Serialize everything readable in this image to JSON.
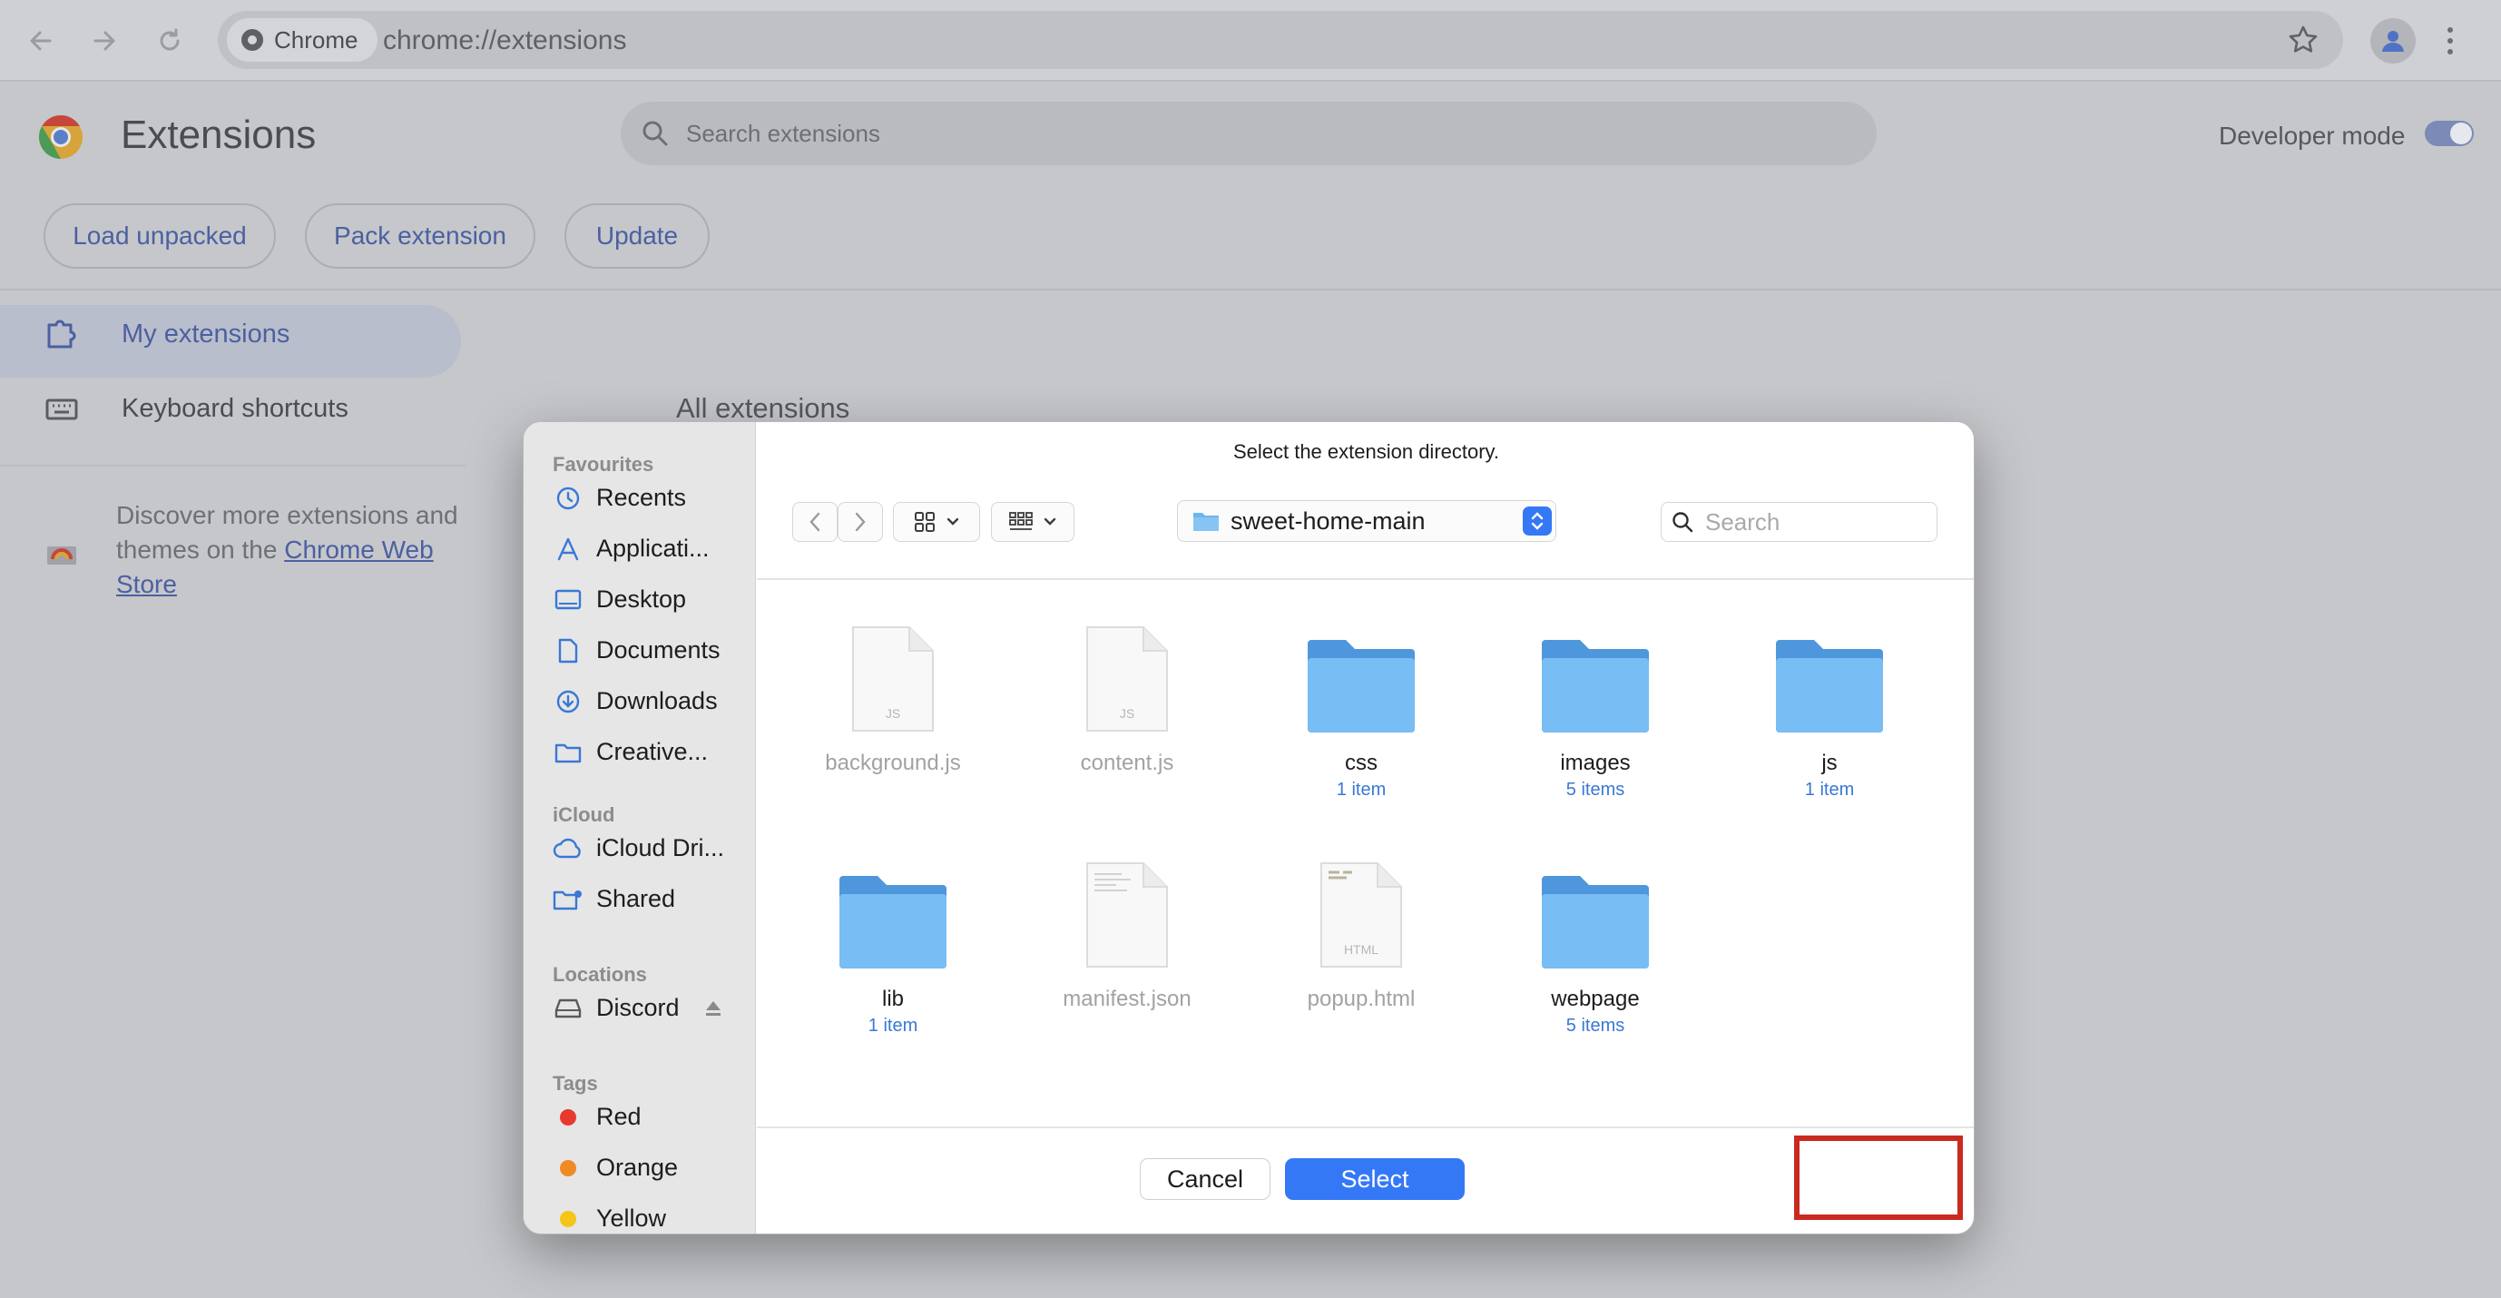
{
  "browser": {
    "chip_label": "Chrome",
    "url": "chrome://extensions"
  },
  "extensions_page": {
    "title": "Extensions",
    "search_placeholder": "Search extensions",
    "developer_mode_label": "Developer mode",
    "developer_mode_on": true,
    "buttons": {
      "load_unpacked": "Load unpacked",
      "pack_extension": "Pack extension",
      "update": "Update"
    },
    "nav": {
      "my_extensions": "My extensions",
      "keyboard_shortcuts": "Keyboard shortcuts"
    },
    "discover": {
      "text": "Discover more extensions and themes on the ",
      "link": "Chrome Web Store"
    },
    "all_extensions_heading": "All extensions"
  },
  "dialog": {
    "prompt": "Select the extension directory.",
    "current_folder": "sweet-home-main",
    "search_placeholder": "Search",
    "sidebar": {
      "favourites_label": "Favourites",
      "favourites": [
        "Recents",
        "Applicati...",
        "Desktop",
        "Documents",
        "Downloads",
        "Creative..."
      ],
      "icloud_label": "iCloud",
      "icloud": [
        "iCloud Dri...",
        "Shared"
      ],
      "locations_label": "Locations",
      "locations": [
        "Discord"
      ],
      "tags_label": "Tags",
      "tags": [
        {
          "name": "Red",
          "color": "#e8392f"
        },
        {
          "name": "Orange",
          "color": "#f08a24"
        },
        {
          "name": "Yellow",
          "color": "#f5c518"
        }
      ]
    },
    "files": [
      {
        "name": "background.js",
        "count": "",
        "kind": "js"
      },
      {
        "name": "content.js",
        "count": "",
        "kind": "js"
      },
      {
        "name": "css",
        "count": "1 item",
        "kind": "folder"
      },
      {
        "name": "images",
        "count": "5 items",
        "kind": "folder"
      },
      {
        "name": "js",
        "count": "1 item",
        "kind": "folder"
      },
      {
        "name": "lib",
        "count": "1 item",
        "kind": "folder"
      },
      {
        "name": "manifest.json",
        "count": "",
        "kind": "json"
      },
      {
        "name": "popup.html",
        "count": "",
        "kind": "html"
      },
      {
        "name": "webpage",
        "count": "5 items",
        "kind": "folder"
      }
    ],
    "file_badges": {
      "js": "JS",
      "html": "HTML"
    },
    "cancel_label": "Cancel",
    "select_label": "Select"
  },
  "colors": {
    "accent": "#3478f6",
    "highlight_box": "#c92a1f",
    "folder": "#6fb4ee"
  }
}
